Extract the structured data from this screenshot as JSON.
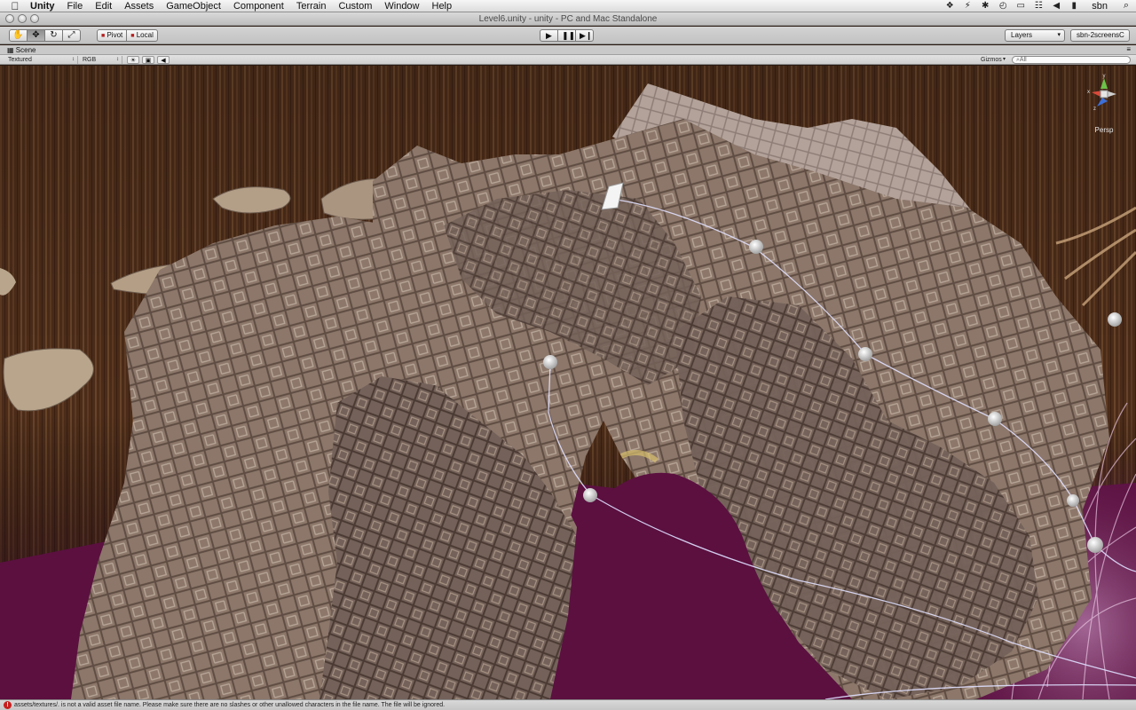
{
  "menubar": {
    "app_name": "Unity",
    "items": [
      "File",
      "Edit",
      "Assets",
      "GameObject",
      "Component",
      "Terrain",
      "Custom",
      "Window",
      "Help"
    ],
    "user": "sbn"
  },
  "window": {
    "title": "Level6.unity - unity - PC and Mac Standalone"
  },
  "toolbar": {
    "pivot_label": "Pivot",
    "local_label": "Local",
    "layers_label": "Layers",
    "layout_label": "sbn-2screensC"
  },
  "scene": {
    "tab_label": "Scene",
    "render_mode": "Textured",
    "color_mode": "RGB",
    "gizmos_label": "Gizmos",
    "search_placeholder": "All",
    "persp_label": "Persp",
    "axis_labels": {
      "x": "x",
      "y": "y",
      "z": "z"
    }
  },
  "status": {
    "message": "assets/textures/. is not a valid asset file name. Please make sure there are no slashes or other unallowed characters in the file name. The file will be ignored."
  },
  "colors": {
    "menubar": "#e8e8e8",
    "toolbar": "#c8c8c8",
    "viewport_sky": "#4a2a17",
    "magenta": "#5b1040",
    "rock": "#8a7566",
    "error_red": "#c81f1f"
  },
  "icons": {
    "apple": "apple-icon",
    "tools": [
      "hand-icon",
      "move-icon",
      "rotate-icon",
      "scale-icon"
    ],
    "play": [
      "play-icon",
      "pause-icon",
      "step-icon"
    ],
    "status": [
      "dropbox-icon",
      "bluetooth-icon",
      "time-machine-icon",
      "display-icon",
      "wifi-icon",
      "volume-icon",
      "battery-icon"
    ]
  }
}
